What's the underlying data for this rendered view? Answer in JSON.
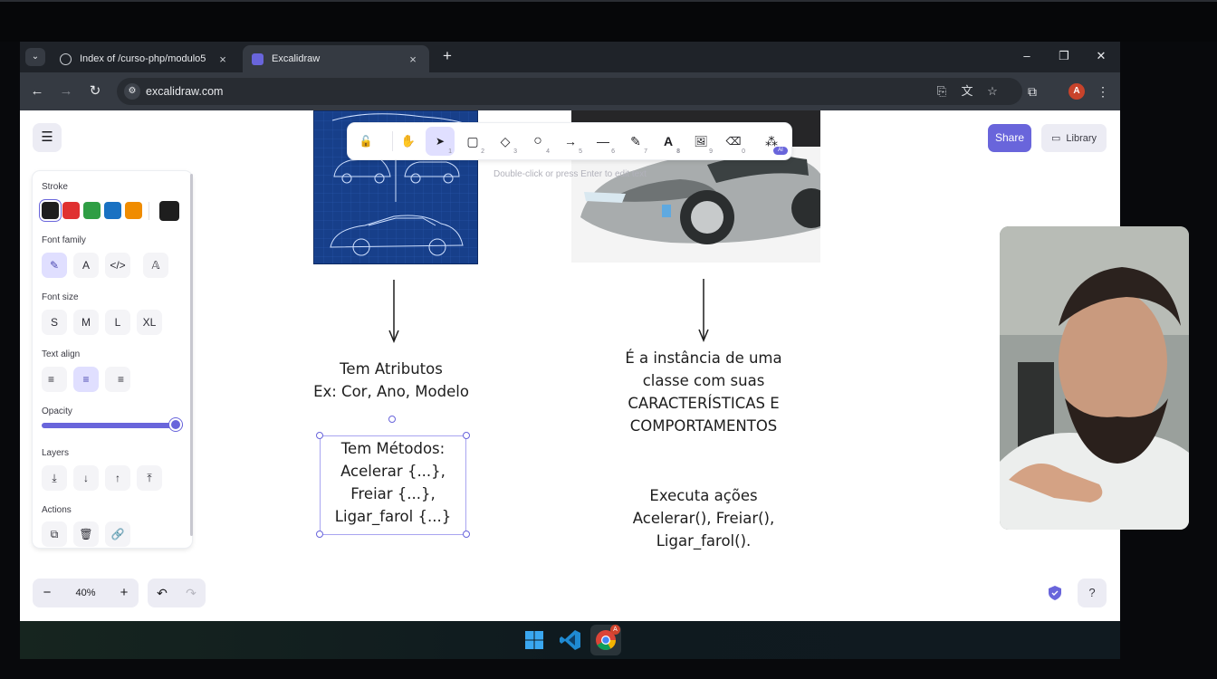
{
  "browser": {
    "tabs": [
      {
        "title": "Index of /curso-php/modulo5",
        "active": false
      },
      {
        "title": "Excalidraw",
        "active": true
      }
    ],
    "tab_close": "×",
    "new_tab": "+",
    "window_controls": {
      "minimize": "–",
      "restore": "❐",
      "close": "✕"
    },
    "url": "excalidraw.com",
    "profile_initial": "A"
  },
  "excalidraw": {
    "menu_icon": "☰",
    "toolbar": {
      "tools": [
        {
          "name": "lock",
          "glyph": "🔓",
          "num": ""
        },
        {
          "name": "hand",
          "glyph": "✋",
          "num": ""
        },
        {
          "name": "selection",
          "glyph": "➤",
          "num": "1"
        },
        {
          "name": "rectangle",
          "glyph": "▢",
          "num": "2"
        },
        {
          "name": "diamond",
          "glyph": "◇",
          "num": "3"
        },
        {
          "name": "ellipse",
          "glyph": "○",
          "num": "4"
        },
        {
          "name": "arrow",
          "glyph": "→",
          "num": "5"
        },
        {
          "name": "line",
          "glyph": "—",
          "num": "6"
        },
        {
          "name": "draw",
          "glyph": "✎",
          "num": "7"
        },
        {
          "name": "text",
          "glyph": "A",
          "num": "8"
        },
        {
          "name": "image",
          "glyph": "🖼",
          "num": "9"
        },
        {
          "name": "eraser",
          "glyph": "⌫",
          "num": "0"
        },
        {
          "name": "more-tools",
          "glyph": "⁂",
          "num": ""
        }
      ],
      "ai_badge": "AI"
    },
    "hint": "Double-click or press Enter to edit text",
    "share_label": "Share",
    "library_label": "Library",
    "properties": {
      "stroke_label": "Stroke",
      "stroke_colors": [
        "#1e1e1e",
        "#e03131",
        "#2f9e44",
        "#1971c2",
        "#f08c00"
      ],
      "current_stroke": "#1e1e1e",
      "font_family_label": "Font family",
      "font_family_options": [
        "✎",
        "A",
        "</>",
        "𝔸"
      ],
      "font_size_label": "Font size",
      "font_sizes": [
        "S",
        "M",
        "L",
        "XL"
      ],
      "text_align_label": "Text align",
      "text_align_options": [
        "≡",
        "≡",
        "≡"
      ],
      "opacity_label": "Opacity",
      "opacity_value": 100,
      "layers_label": "Layers",
      "layers_options": [
        "⤓",
        "↓",
        "↑",
        "⤒"
      ],
      "actions_label": "Actions",
      "actions_options": [
        "⧉",
        "🗑",
        "🔗"
      ]
    },
    "canvas": {
      "text_left_1": "Tem Atributos",
      "text_left_2": "Ex: Cor, Ano, Modelo",
      "methods_box": [
        "Tem Métodos:",
        "Acelerar {...},",
        "Freiar {...},",
        "Ligar_farol {...}"
      ],
      "text_right": [
        "É a instância de uma",
        "classe com suas",
        "CARACTERÍSTICAS E",
        "COMPORTAMENTOS"
      ],
      "text_right_2": [
        "Executa ações",
        "Acelerar(), Freiar(),",
        "Ligar_farol()."
      ]
    },
    "zoom": {
      "minus": "−",
      "value": "40%",
      "plus": "+"
    },
    "undo": "↶",
    "redo": "↷",
    "help": "?"
  }
}
